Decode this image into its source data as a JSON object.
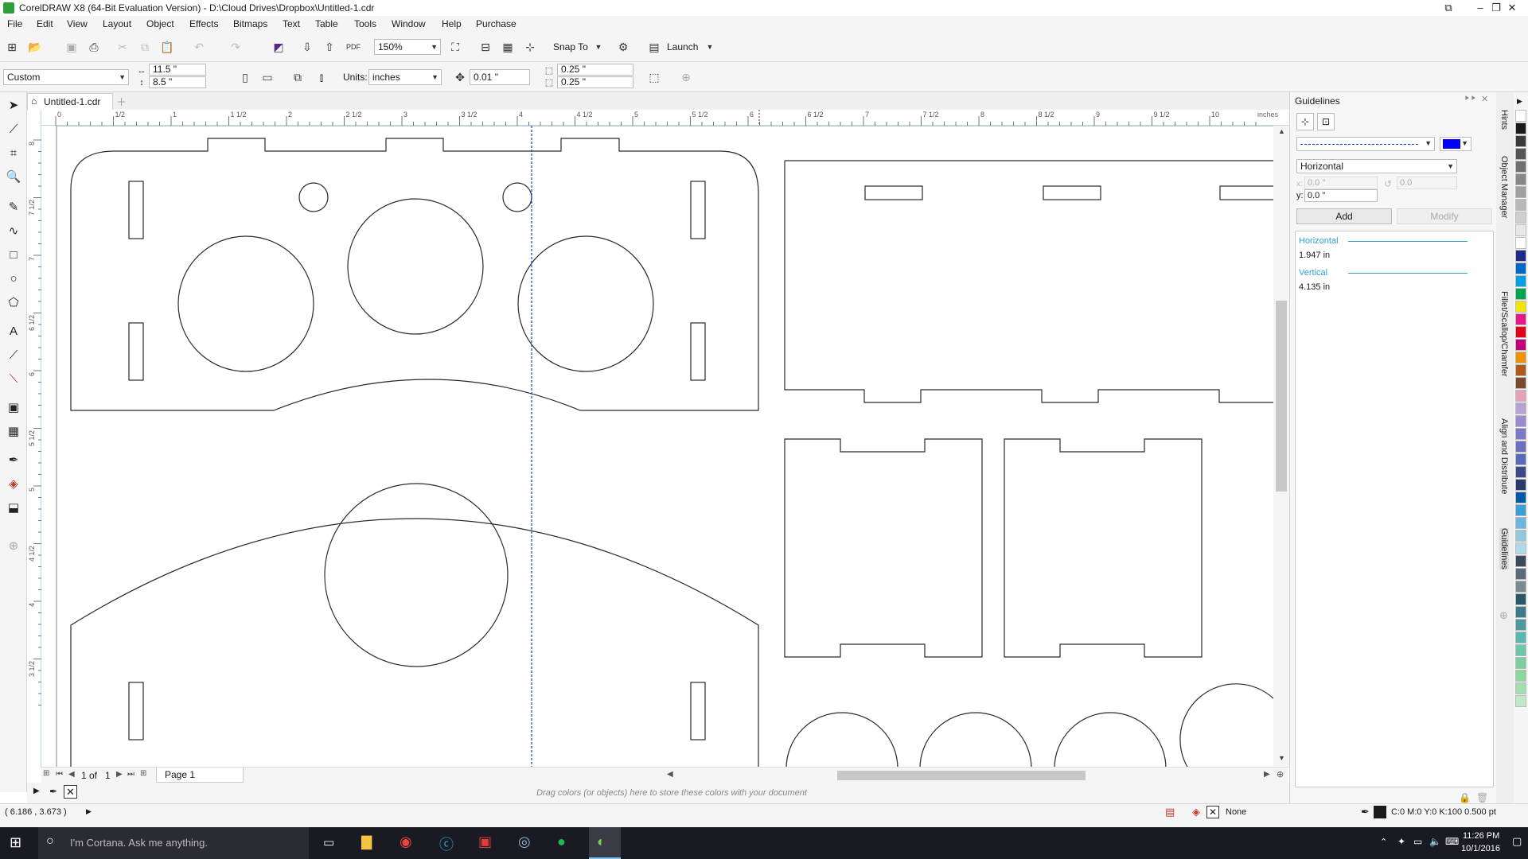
{
  "window": {
    "title": "CorelDRAW X8 (64-Bit Evaluation Version) - D:\\Cloud Drives\\Dropbox\\Untitled-1.cdr"
  },
  "menu": [
    "File",
    "Edit",
    "View",
    "Layout",
    "Object",
    "Effects",
    "Bitmaps",
    "Text",
    "Table",
    "Tools",
    "Window",
    "Help",
    "Purchase"
  ],
  "toolbar": {
    "zoom": "150%",
    "snap_to": "Snap To",
    "launch": "Launch"
  },
  "propbar": {
    "page_preset": "Custom",
    "width": "11.5 \"",
    "height": "8.5 \"",
    "units_label": "Units:",
    "units": "inches",
    "nudge": "0.01 \"",
    "dup_x": "0.25 \"",
    "dup_y": "0.25 \""
  },
  "doc": {
    "tab": "Untitled-1.cdr",
    "page_of": "1",
    "page_total": "1",
    "page_label": "Page 1"
  },
  "ruler": {
    "h_labels": [
      "0",
      "1/2",
      "1",
      "1 1/2",
      "2",
      "2 1/2",
      "3",
      "3 1/2",
      "4",
      "4 1/2",
      "5",
      "5 1/2",
      "6",
      "6 1/2",
      "7",
      "7 1/2",
      "8",
      "8 1/2",
      "9",
      "9 1/2",
      "10"
    ],
    "units": "inches",
    "v_labels": [
      "8",
      "7 1/2",
      "7",
      "6 1/2",
      "6",
      "5 1/2",
      "5",
      "4 1/2",
      "4",
      "3 1/2"
    ]
  },
  "panel": {
    "title": "Guidelines",
    "type_select": "Horizontal",
    "x_value": "0.0 \"",
    "y_label": "y:",
    "y_value": "0.0 \"",
    "angle_value": "0.0",
    "add_label": "Add",
    "modify_label": "Modify",
    "list": [
      {
        "label": "Horizontal",
        "value": "1.947 in"
      },
      {
        "label": "Vertical",
        "value": "4.135 in"
      }
    ]
  },
  "sidetabs": [
    "Hints",
    "Object Manager",
    "Fillet/Scallop/Chamfer",
    "Align and Distribute",
    "Guidelines"
  ],
  "colortray": {
    "hint": "Drag colors (or objects) here to store these colors with your document"
  },
  "status": {
    "coords": "( 6.186 , 3.673 )",
    "fill": "None",
    "outline": "C:0 M:0 Y:0 K:100  0.500 pt"
  },
  "taskbar": {
    "search": "I'm Cortana. Ask me anything.",
    "time": "11:26 PM",
    "date": "10/1/2016"
  },
  "colors": {
    "guideline": "#1a3fd0",
    "guide_color_swatch": "#0000ff",
    "accent": "#2ea0d8"
  }
}
